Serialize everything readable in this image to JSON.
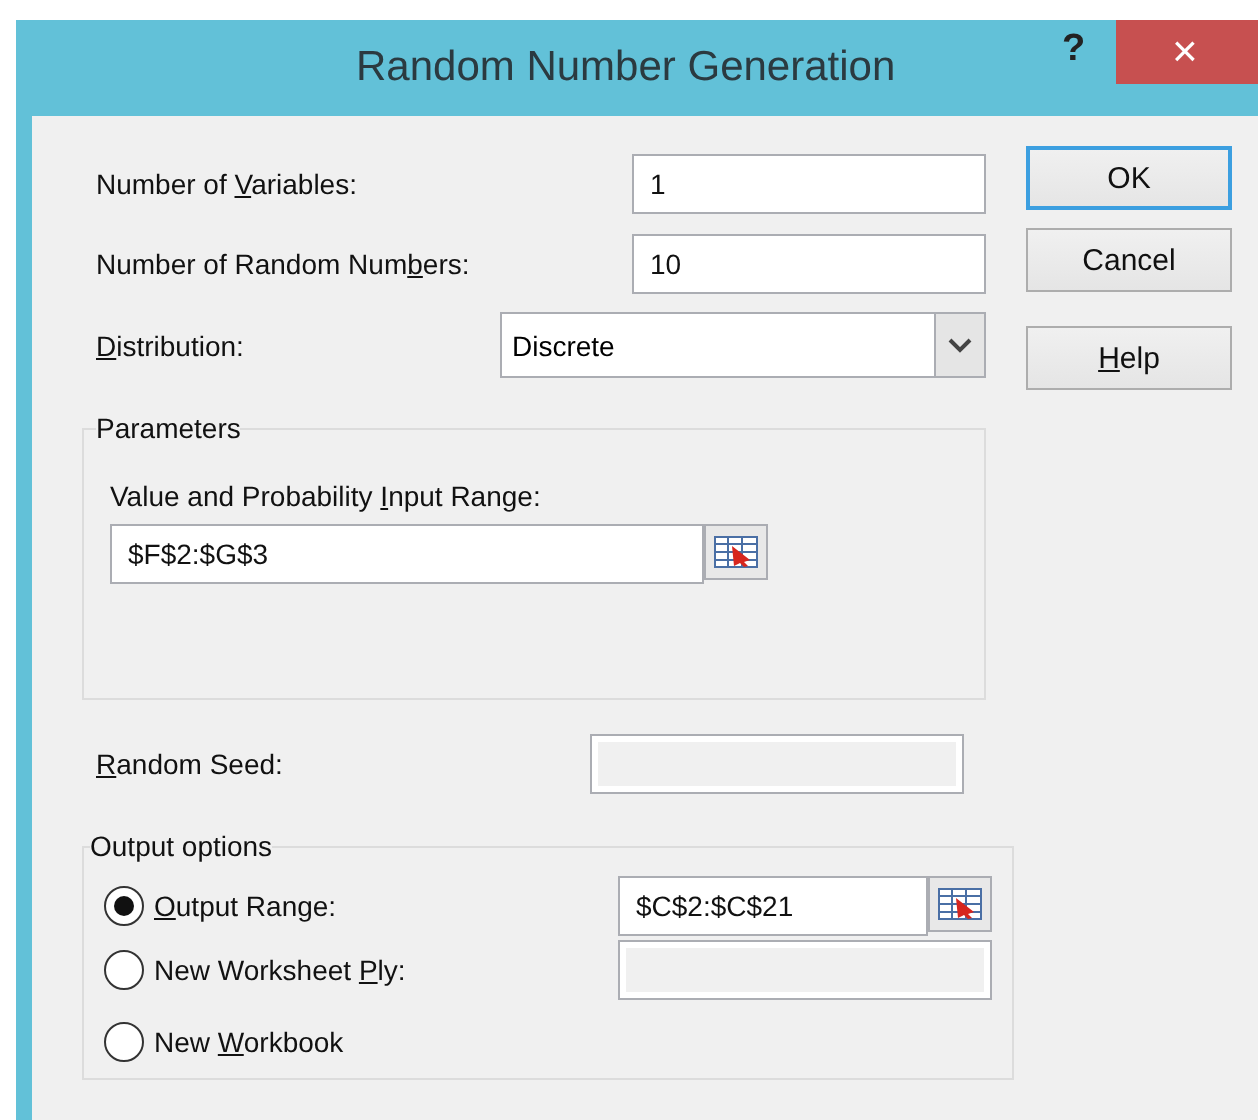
{
  "window": {
    "title": "Random Number Generation",
    "help": "?",
    "close": "×"
  },
  "fields": [
    {
      "label": {
        "before": "Number of ",
        "key": "V",
        "after": "ariables:"
      },
      "value": "1"
    },
    {
      "label": {
        "before": "Number of Random Num",
        "key": "b",
        "after": "ers:"
      },
      "value": "10"
    }
  ],
  "distribution": {
    "label": {
      "key": "D",
      "after": "istribution:"
    },
    "value": "Discrete"
  },
  "buttons": [
    {
      "label": {
        "before": "OK"
      },
      "default": true
    },
    {
      "label": {
        "before": "Cancel"
      },
      "default": false
    },
    {
      "label": {
        "key": "H",
        "after": "elp"
      },
      "default": false
    }
  ],
  "parameters": {
    "title": "Parameters",
    "label": {
      "before": "Value and Probability ",
      "key": "I",
      "after": "nput Range:"
    },
    "value": "$F$2:$G$3"
  },
  "random_seed": {
    "label": {
      "key": "R",
      "after": "andom Seed:"
    }
  },
  "output_options": {
    "title": "Output options",
    "options": [
      {
        "label": {
          "key": "O",
          "after": "utput Range:"
        },
        "selected": true,
        "value": "$C$2:$C$21",
        "kind": "range"
      },
      {
        "label": {
          "before": "New Worksheet ",
          "key": "P",
          "after": "ly:"
        },
        "selected": false,
        "kind": "text"
      },
      {
        "label": {
          "before": "New ",
          "key": "W",
          "after": "orkbook"
        },
        "selected": false,
        "kind": "none"
      }
    ]
  }
}
